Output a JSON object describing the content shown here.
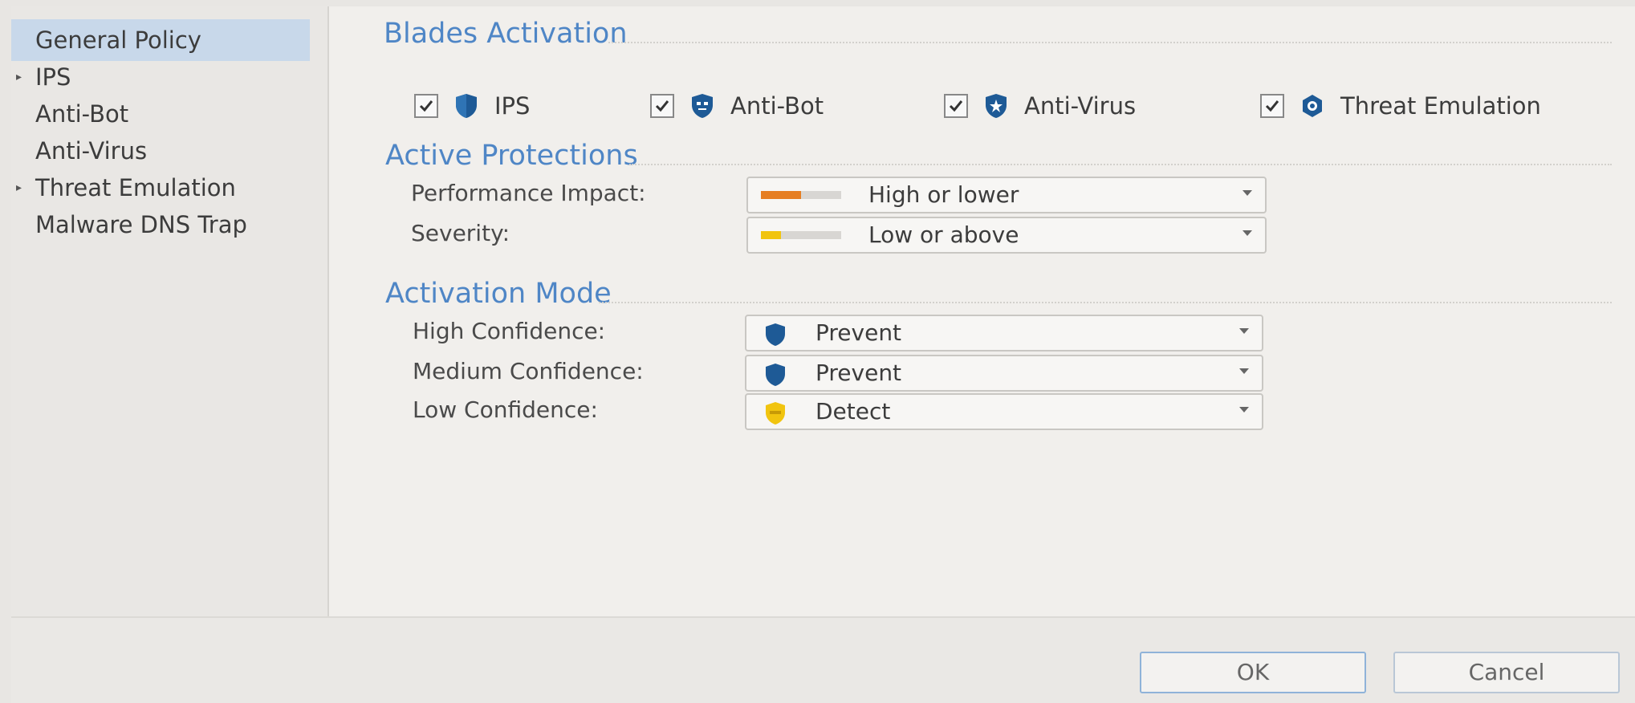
{
  "sidebar": {
    "items": [
      {
        "label": "General Policy",
        "active": true,
        "expandable": false
      },
      {
        "label": "IPS",
        "active": false,
        "expandable": true
      },
      {
        "label": "Anti-Bot",
        "active": false,
        "expandable": false
      },
      {
        "label": "Anti-Virus",
        "active": false,
        "expandable": false
      },
      {
        "label": "Threat Emulation",
        "active": false,
        "expandable": true
      },
      {
        "label": "Malware DNS Trap",
        "active": false,
        "expandable": false
      }
    ]
  },
  "blades": {
    "title": "Blades Activation",
    "items": [
      {
        "label": "IPS",
        "checked": true,
        "icon": "shield-icon"
      },
      {
        "label": "Anti-Bot",
        "checked": true,
        "icon": "bot-icon"
      },
      {
        "label": "Anti-Virus",
        "checked": true,
        "icon": "virus-icon"
      },
      {
        "label": "Threat Emulation",
        "checked": true,
        "icon": "emulation-icon"
      }
    ]
  },
  "protections": {
    "title": "Active Protections",
    "performance_label": "Performance Impact:",
    "performance_value": "High or lower",
    "severity_label": "Severity:",
    "severity_value": "Low or above"
  },
  "activation": {
    "title": "Activation Mode",
    "high_label": "High Confidence:",
    "high_value": "Prevent",
    "medium_label": "Medium Confidence:",
    "medium_value": "Prevent",
    "low_label": "Low Confidence:",
    "low_value": "Detect"
  },
  "buttons": {
    "ok": "OK",
    "cancel": "Cancel"
  },
  "colors": {
    "accent": "#4f86c6",
    "shield": "#1e5a96",
    "impact_bar": "#e67e22",
    "severity_bar": "#f1c40f"
  }
}
